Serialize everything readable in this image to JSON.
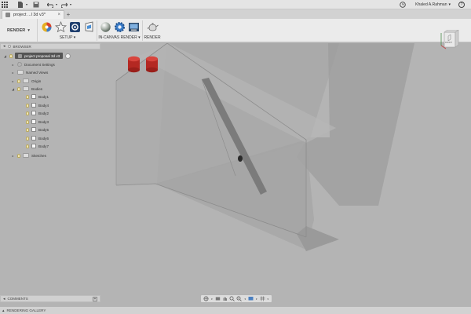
{
  "titlebar": {
    "user_name": "Khaled A.Rahman",
    "user_caret": "▾",
    "help_glyph": "?",
    "icons": [
      "apps-grid-icon",
      "file-icon",
      "save-icon",
      "undo-icon",
      "redo-icon",
      "clock-icon",
      "help-icon"
    ]
  },
  "tabs": [
    {
      "label": "project ...l 3d v3*",
      "close": "×"
    }
  ],
  "tab_add": "+",
  "toolbar": {
    "workspace_label": "RENDER",
    "workspace_caret": "▾",
    "groups": [
      {
        "label": "SETUP ▾"
      },
      {
        "label": "IN-CANVAS RENDER ▾"
      },
      {
        "label": "RENDER"
      }
    ]
  },
  "browser": {
    "header": "BROWSER",
    "root": "project proposal 3d v3",
    "items": [
      {
        "label": "Document Settings",
        "level": 1
      },
      {
        "label": "Named Views",
        "level": 1
      },
      {
        "label": "Origin",
        "level": 1
      },
      {
        "label": "Bodies",
        "level": 1
      },
      {
        "label": "Body1",
        "level": 2
      },
      {
        "label": "Body4",
        "level": 2
      },
      {
        "label": "Body2",
        "level": 2
      },
      {
        "label": "Body3",
        "level": 2
      },
      {
        "label": "Body5",
        "level": 2
      },
      {
        "label": "Body6",
        "level": 2
      },
      {
        "label": "Body7",
        "level": 2
      },
      {
        "label": "Sketches",
        "level": 1
      }
    ]
  },
  "viewcube": {
    "face_label": "FRONT"
  },
  "comments": {
    "label": "COMMENTS",
    "add": "+"
  },
  "gallery": {
    "label": "RENDERING GALLERY",
    "caret": "▴"
  },
  "colors": {
    "canvas_bg": "#b4b4b4",
    "cylinder_red": "#c8302a",
    "toolbar_bg": "#ebebeb"
  }
}
